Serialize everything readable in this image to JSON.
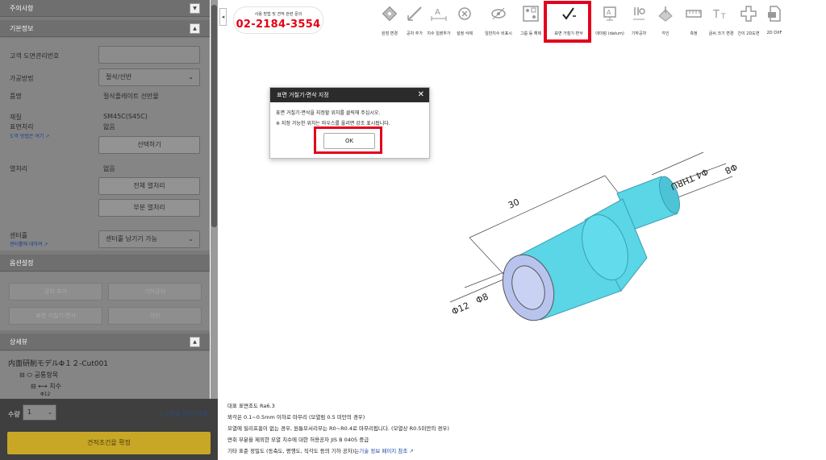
{
  "left_panel": {
    "notice_header": "주의사항",
    "basic_info_header": "기본정보",
    "customer_drawing_label": "고객 도면관리번호",
    "customer_drawing_value": "",
    "processing_label": "가공방법",
    "processing_value": "절삭/선반",
    "product_label": "품명",
    "product_value": "절삭플레이트 선반물",
    "material_label": "재질",
    "material_value": "SM45C(S45C)",
    "surface_label": "표면처리",
    "surface_link": "도막 방법은 여기",
    "surface_value": "없음",
    "select_button": "선택하기",
    "heat_label": "열처리",
    "heat_value": "없음",
    "full_heat_button": "전체 열처리",
    "partial_heat_button": "부분 열처리",
    "center_hole_label": "센터홀",
    "center_hole_link": "센터홀에 대하여",
    "center_hole_value": "센터홀 남기기 가능",
    "options_header": "옵션설정",
    "opt_buttons": [
      "공차 추가",
      "기하공차",
      "표면 거칠기·면삭",
      "각인"
    ],
    "detail_view_header": "상세뷰",
    "tree_root": "内面研削モデルΦ１２-Cut001",
    "tree_common": "공통항목",
    "tree_dimension": "치수",
    "tree_dim_icon": "Φ",
    "tree_dim_partial": "Φ12"
  },
  "bottom_bar": {
    "qty_label": "수량",
    "qty_value": "1",
    "discount_link": "수량별 할인가격표",
    "confirm_button": "견적조건을 확정"
  },
  "phone": {
    "caption": "사용 방법 및 견적 관련 문의",
    "number": "02-2184-3554"
  },
  "toolbar": [
    {
      "icon": "edit-original-icon",
      "label": "원점 변경"
    },
    {
      "icon": "add-tolerance-icon",
      "label": "공차 추가"
    },
    {
      "icon": "dimension-blank-icon",
      "label": "치수 일괄추가"
    },
    {
      "icon": "clear-setting-icon",
      "label": "설정 삭제"
    },
    {
      "icon": "hide-dimension-icon",
      "label": "일반치수 비표시"
    },
    {
      "icon": "group-release-icon",
      "label": "그룹 등 해제"
    },
    {
      "icon": "surface-roughness-icon",
      "label": "표면 거칠기·면삭"
    },
    {
      "icon": "datum-icon",
      "label": "데이텀 (datum)"
    },
    {
      "icon": "geometric-tolerance-icon",
      "label": "기하공차"
    },
    {
      "icon": "engrave-icon",
      "label": "각인"
    },
    {
      "icon": "measure-icon",
      "label": "측정"
    },
    {
      "icon": "font-size-icon",
      "label": "글씨 크기 변경"
    },
    {
      "icon": "view-2d-icon",
      "label": "간이 2D도면"
    },
    {
      "icon": "dxf-icon",
      "label": "2D DXF"
    }
  ],
  "dialog": {
    "title": "표면 거칠기·면삭 지정",
    "line1": "표면 거칠기·면삭을 지정할 위치를 클릭해 주십시오.",
    "line2": "※ 지정 가능한 위치는 마우스를 올리면 강조 표시됩니다.",
    "ok": "OK"
  },
  "model": {
    "dim_length": "30",
    "dim_outer": "Φ12",
    "dim_inner": "Φ8",
    "dim_thru": "Φ4 THRU",
    "dim_step": "Φ8",
    "body_color": "#5ad6e6",
    "face_color": "#b8c4ee"
  },
  "notes": {
    "line1": "대표 표면조도 Ra6.3",
    "line2": "뫼각은 0.1~0.5mm 이하로 마무리 (모열림 0.5 미만의 경우)",
    "line3": "모열에 릴리프홈이 없는 경우, 원통모서리부는 R0~R0.4로 마무리됩니다. (모열상 R0.5미만의 경우)",
    "line4": "면취 부분을 제외한 모열 치수에 대한 허용공차 JIS B 0405 중급",
    "line5_prefix": "기타 표준 정밀도 (동축도, 평행도, 직각도 등의 기하 공차)는",
    "line5_link": "기술 정보 페이지 참조"
  }
}
